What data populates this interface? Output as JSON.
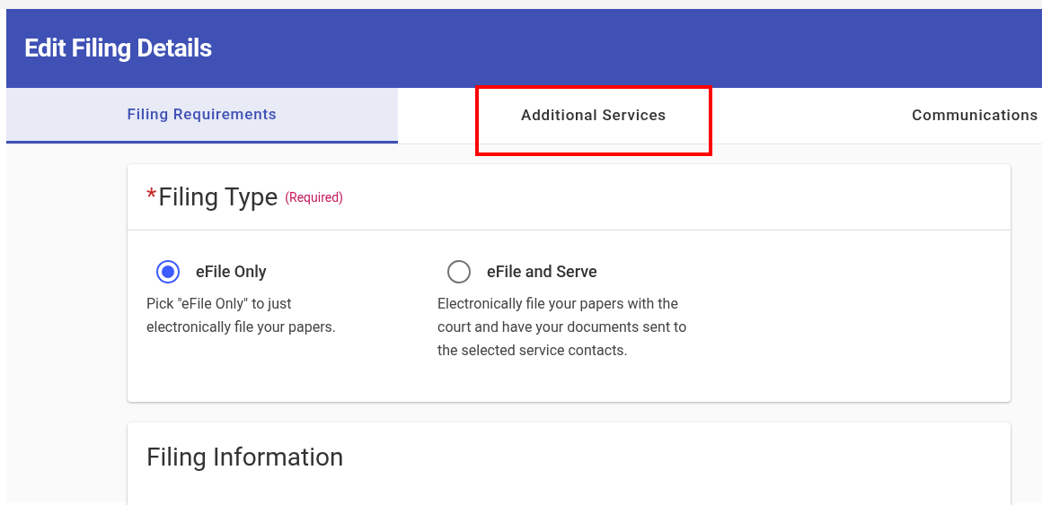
{
  "header": {
    "title": "Edit Filing Details"
  },
  "tabs": [
    {
      "label": "Filing Requirements",
      "selected": true,
      "annotated": false
    },
    {
      "label": "Additional Services",
      "selected": false,
      "annotated": true
    },
    {
      "label": "Communications",
      "selected": false,
      "annotated": false
    }
  ],
  "filing_type": {
    "required_mark": "*",
    "title": "Filing Type",
    "required_note": "(Required)",
    "options": [
      {
        "label": "eFile Only",
        "description": "Pick \"eFile Only\" to just electronically file your papers.",
        "selected": true
      },
      {
        "label": "eFile and Serve",
        "description": "Electronically file your papers with the court and have your documents sent to the selected service contacts.",
        "selected": false
      }
    ]
  },
  "filing_information": {
    "title": "Filing Information"
  }
}
